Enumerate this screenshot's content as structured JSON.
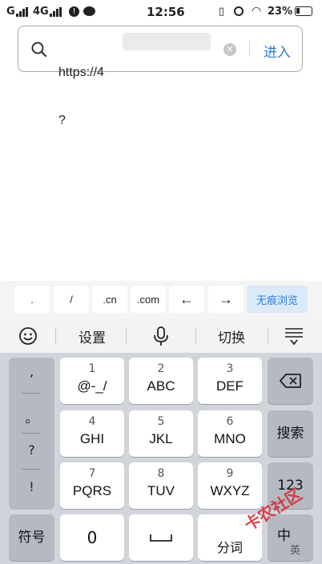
{
  "status": {
    "carrier1": "G",
    "carrier2": "4G",
    "time": "12:56",
    "battery": "23%"
  },
  "urlbar": {
    "url": "https://4",
    "url_line2": "?",
    "enter_label": "进入"
  },
  "shortcuts": [
    ".",
    "/",
    ".cn",
    ".com",
    "←",
    "→",
    "无痕浏览"
  ],
  "toolbar": {
    "settings_label": "设置",
    "switch_label": "切换"
  },
  "keyboard": {
    "punct": [
      ",",
      "。",
      "?",
      "!"
    ],
    "keys": [
      {
        "num": "1",
        "label": "@-_/"
      },
      {
        "num": "2",
        "label": "ABC"
      },
      {
        "num": "3",
        "label": "DEF"
      },
      {
        "num": "4",
        "label": "GHI"
      },
      {
        "num": "5",
        "label": "JKL"
      },
      {
        "num": "6",
        "label": "MNO"
      },
      {
        "num": "7",
        "label": "PQRS"
      },
      {
        "num": "8",
        "label": "TUV"
      },
      {
        "num": "9",
        "label": "WXYZ"
      }
    ],
    "search_label": "搜索",
    "num_switch_label": "123",
    "symbols_label": "符号",
    "zero_label": "0",
    "segment_label": "分词",
    "chinese_label": "中",
    "english_label": "英"
  },
  "watermark": "卡农社区"
}
